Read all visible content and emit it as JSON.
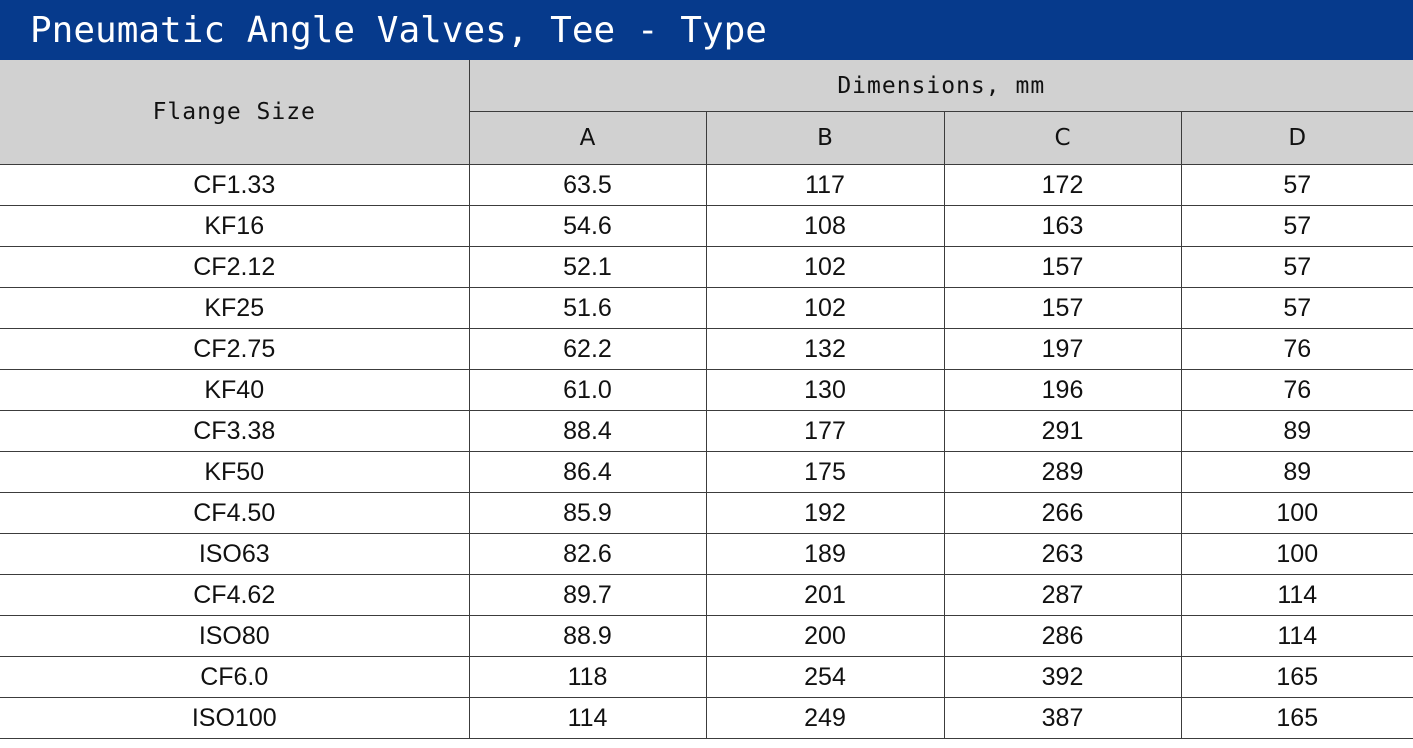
{
  "title": "Pneumatic Angle Valves, Tee - Type",
  "table": {
    "flange_header": "Flange Size",
    "group_header": "Dimensions, mm",
    "columns": [
      "A",
      "B",
      "C",
      "D"
    ],
    "rows": [
      {
        "flange": "CF1.33",
        "A": "63.5",
        "B": "117",
        "C": "172",
        "D": "57"
      },
      {
        "flange": "KF16",
        "A": "54.6",
        "B": "108",
        "C": "163",
        "D": "57"
      },
      {
        "flange": "CF2.12",
        "A": "52.1",
        "B": "102",
        "C": "157",
        "D": "57"
      },
      {
        "flange": "KF25",
        "A": "51.6",
        "B": "102",
        "C": "157",
        "D": "57"
      },
      {
        "flange": "CF2.75",
        "A": "62.2",
        "B": "132",
        "C": "197",
        "D": "76"
      },
      {
        "flange": "KF40",
        "A": "61.0",
        "B": "130",
        "C": "196",
        "D": "76"
      },
      {
        "flange": "CF3.38",
        "A": "88.4",
        "B": "177",
        "C": "291",
        "D": "89"
      },
      {
        "flange": "KF50",
        "A": "86.4",
        "B": "175",
        "C": "289",
        "D": "89"
      },
      {
        "flange": "CF4.50",
        "A": "85.9",
        "B": "192",
        "C": "266",
        "D": "100"
      },
      {
        "flange": "ISO63",
        "A": "82.6",
        "B": "189",
        "C": "263",
        "D": "100"
      },
      {
        "flange": "CF4.62",
        "A": "89.7",
        "B": "201",
        "C": "287",
        "D": "114"
      },
      {
        "flange": "ISO80",
        "A": "88.9",
        "B": "200",
        "C": "286",
        "D": "114"
      },
      {
        "flange": "CF6.0",
        "A": "118",
        "B": "254",
        "C": "392",
        "D": "165"
      },
      {
        "flange": "ISO100",
        "A": "114",
        "B": "249",
        "C": "387",
        "D": "165"
      }
    ]
  },
  "colors": {
    "title_bg": "#063a8c",
    "header_bg": "#d1d1d1",
    "border": "#3c3c3c"
  }
}
